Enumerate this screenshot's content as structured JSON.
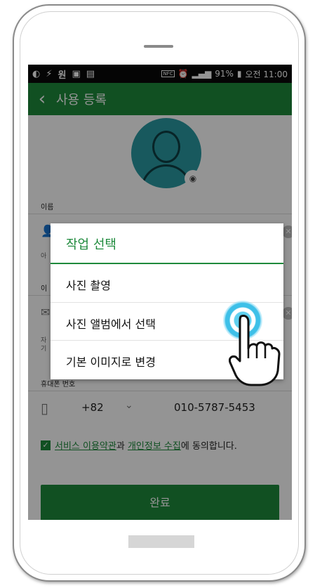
{
  "status_bar": {
    "left_icons": [
      "flipboard-icon",
      "bolt-icon",
      "won-icon",
      "image-icon",
      "clipboard-icon"
    ],
    "won_glyph": "원",
    "nfc": "NFC",
    "battery": "91%",
    "time": "오전 11:00"
  },
  "app_bar": {
    "title": "사용 등록"
  },
  "form": {
    "name_label": "이름",
    "name_hint": "아",
    "email_label": "이",
    "email_hint_1": "자",
    "email_hint_2": "기",
    "phone_label": "휴대폰 번호",
    "country_code": "+82",
    "phone_number": "010-5787-5453"
  },
  "agreement": {
    "terms_link": "서비스 이용약관",
    "conj": "과 ",
    "privacy_link": "개인정보 수집",
    "suffix": "에 동의합니다."
  },
  "complete_button": "완료",
  "dialog": {
    "title": "작업 선택",
    "items": [
      "사진 촬영",
      "사진 앨범에서 선택",
      "기본 이미지로 변경"
    ]
  },
  "colors": {
    "accent": "#1e8a3c",
    "status_bar": "#0a0a0a",
    "avatar": "#2a9aa2"
  }
}
